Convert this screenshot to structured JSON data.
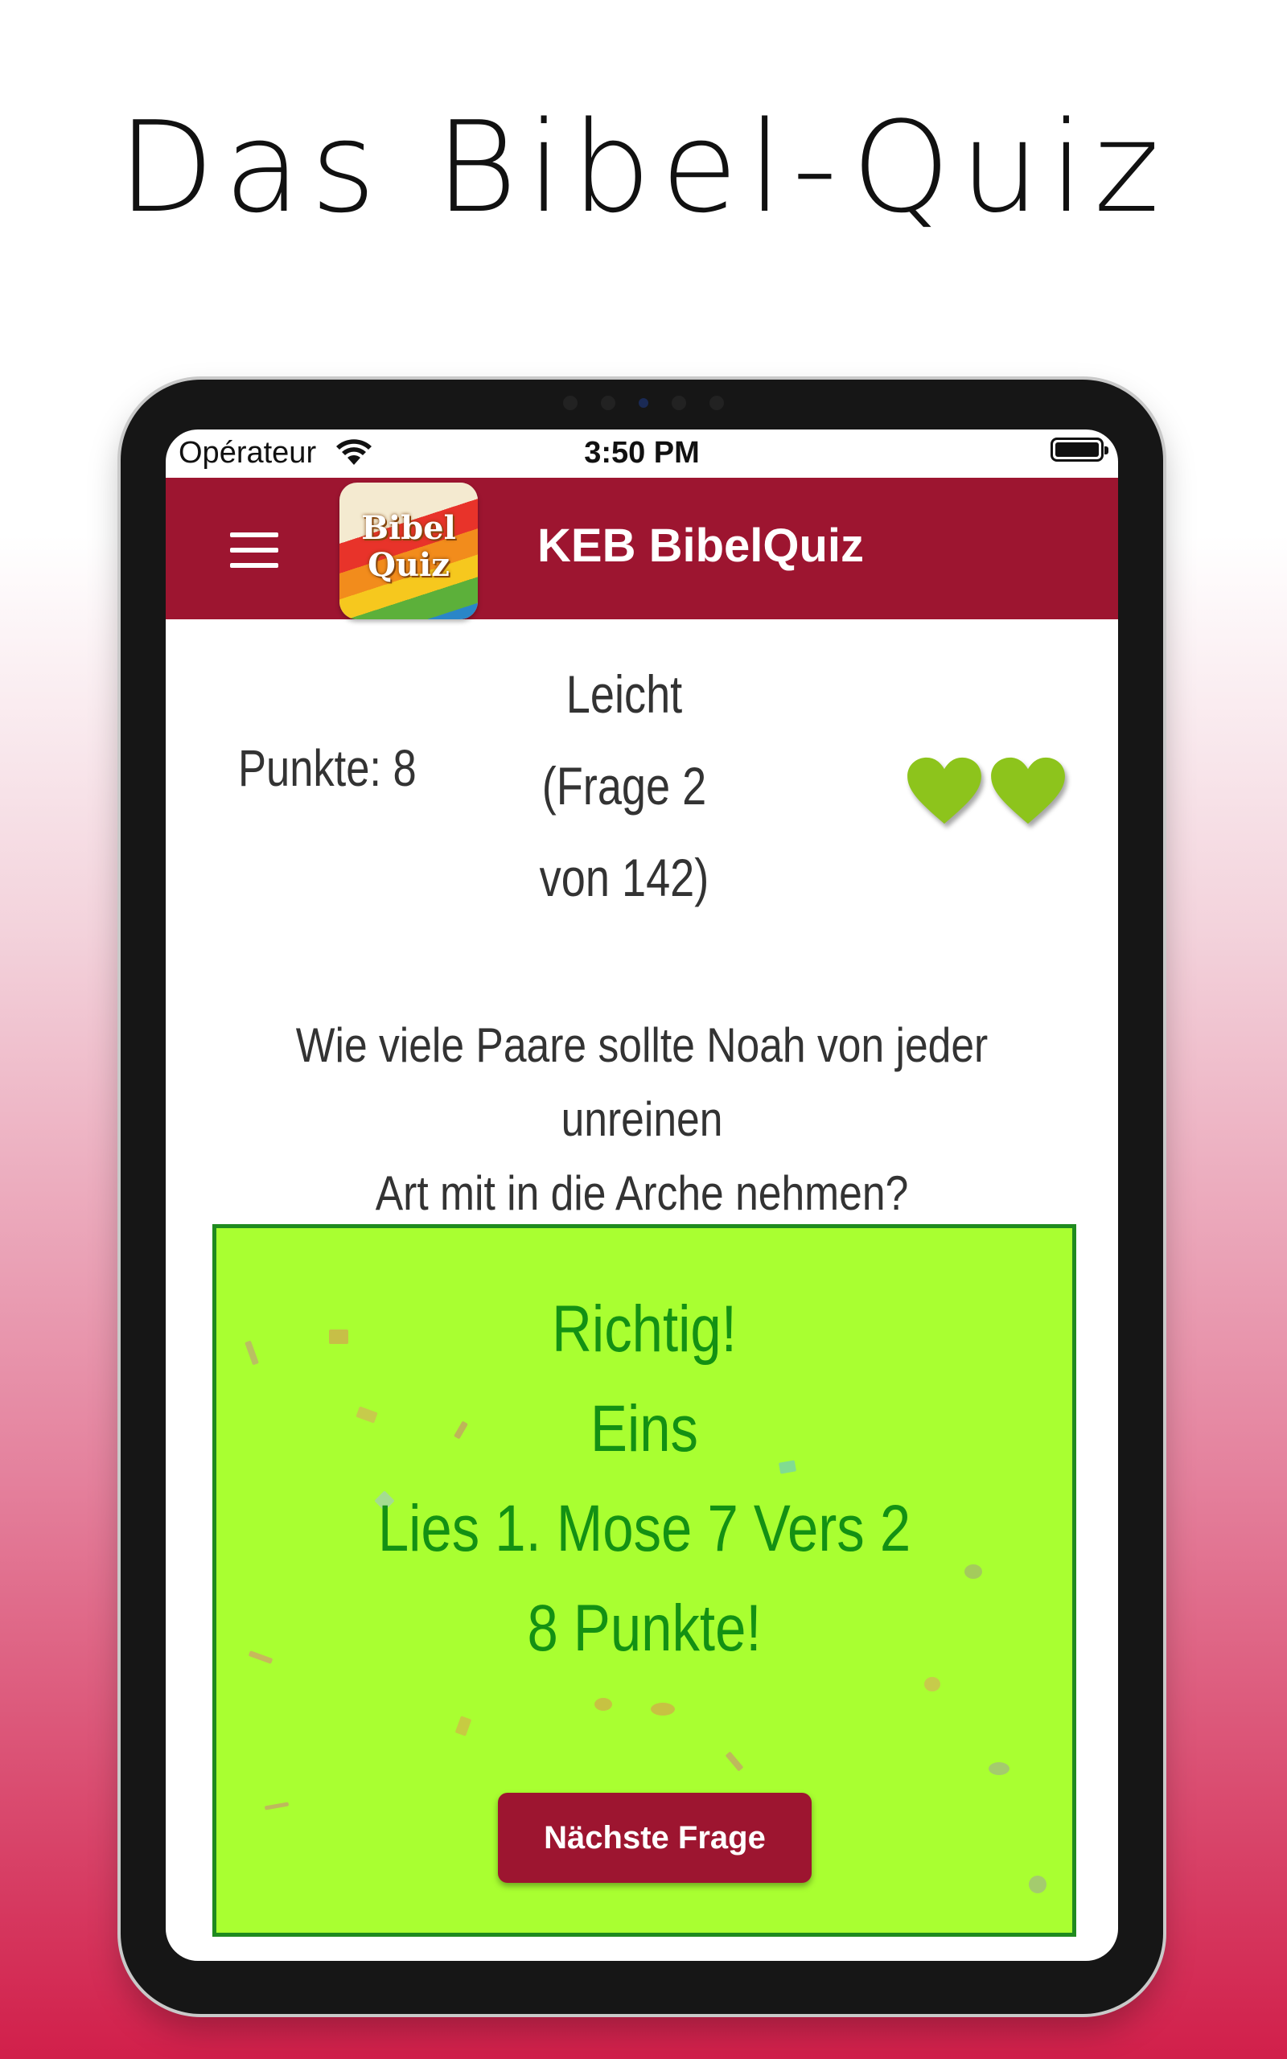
{
  "promo": {
    "title": "Das Bibel-Quiz"
  },
  "statusbar": {
    "carrier": "Opérateur",
    "time": "3:50 PM"
  },
  "appbar": {
    "logo_line1": "Bibel",
    "logo_line2": "Quiz",
    "title": "KEB BibelQuiz"
  },
  "quiz": {
    "points": "Punkte: 8",
    "level_line1": "Leicht",
    "level_line2": "(Frage 2",
    "level_line3": "von 142)",
    "hearts_remaining": 2,
    "question_line1": "Wie viele Paare sollte Noah von jeder unreinen",
    "question_line2": "Art mit in die Arche nehmen?"
  },
  "result": {
    "line1": "Richtig!",
    "line2": "Eins",
    "line3": "Lies 1. Mose 7 Vers 2",
    "line4": "8 Punkte!",
    "next_button": "Nächste Frage"
  },
  "colors": {
    "brand": "#9d1530",
    "answer_bg": "#a9ff31",
    "answer_text": "#139113",
    "heart": "#8dc41c"
  },
  "icons": {
    "menu": "hamburger-menu-icon",
    "wifi": "wifi-icon",
    "battery": "battery-icon",
    "heart": "heart-icon"
  }
}
